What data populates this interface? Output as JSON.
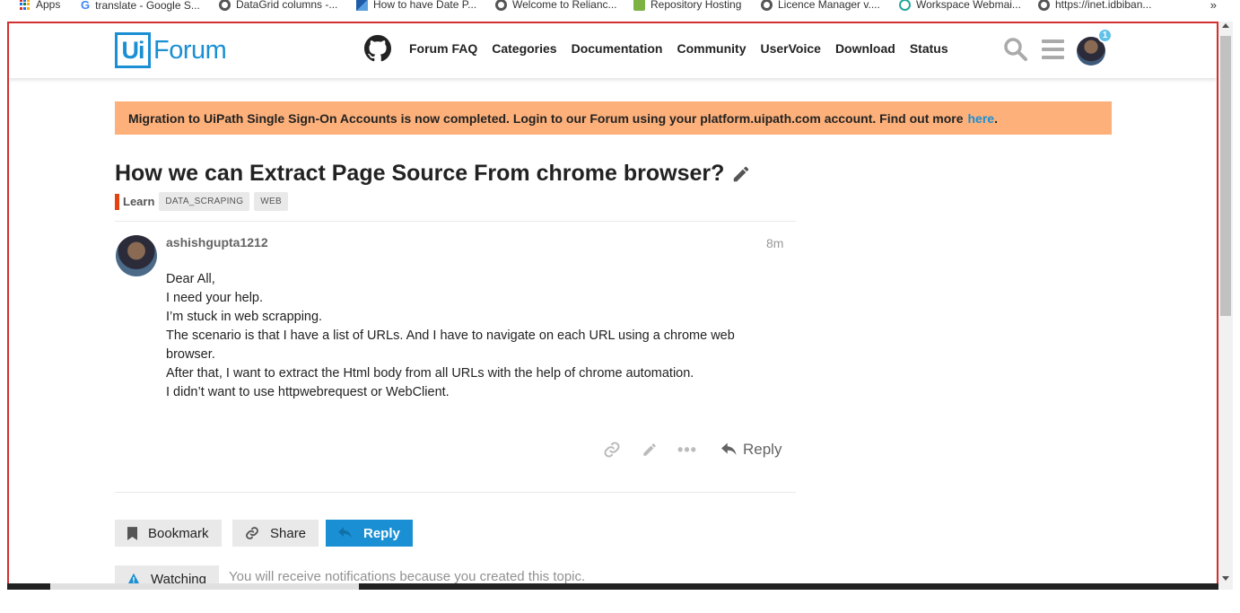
{
  "bookmarks": [
    {
      "label": "Apps",
      "icon": "apps-grid-icon"
    },
    {
      "label": "translate - Google S...",
      "icon": "google-icon"
    },
    {
      "label": "DataGrid columns -...",
      "icon": "globe-icon"
    },
    {
      "label": "How to have Date P...",
      "icon": "stack-icon"
    },
    {
      "label": "Welcome to Relianc...",
      "icon": "globe-icon"
    },
    {
      "label": "Repository Hosting",
      "icon": "plant-icon"
    },
    {
      "label": "Licence Manager v....",
      "icon": "globe-icon"
    },
    {
      "label": "Workspace Webmai...",
      "icon": "swirl-icon"
    },
    {
      "label": "https://inet.idbiban...",
      "icon": "globe-icon"
    }
  ],
  "bookmarks_more": "»",
  "header": {
    "logo_box": "Ui",
    "logo_text": "Forum",
    "nav": [
      "Forum FAQ",
      "Categories",
      "Documentation",
      "Community",
      "UserVoice",
      "Download",
      "Status"
    ],
    "notification_count": "1"
  },
  "banner": {
    "text": "Migration to UiPath Single Sign-On Accounts is now completed. Login to our Forum using your platform.uipath.com account. Find out more",
    "link": "here",
    "suffix": "."
  },
  "topic": {
    "title": "How we can Extract Page Source From chrome browser?",
    "category": "Learn",
    "tags": [
      "DATA_SCRAPING",
      "WEB"
    ]
  },
  "post": {
    "username": "ashishgupta1212",
    "time": "8m",
    "lines": [
      "Dear All,",
      "I need your help.",
      "I’m stuck in web scrapping.",
      "The scenario is that I have a list of URLs. And I have to navigate on each URL using a chrome web browser.",
      "After that, I want to extract the Html body from all URLs with the help of chrome automation.",
      "I didn’t want to use httpwebrequest or WebClient."
    ],
    "reply_label": "Reply"
  },
  "footer": {
    "bookmark_label": "Bookmark",
    "share_label": "Share",
    "reply_label": "Reply",
    "watching_label": "Watching",
    "watching_text": "You will receive notifications because you created this topic."
  },
  "colors": {
    "brand": "#1a8fd3",
    "banner": "#fdb07a",
    "category": "#e4420f"
  }
}
